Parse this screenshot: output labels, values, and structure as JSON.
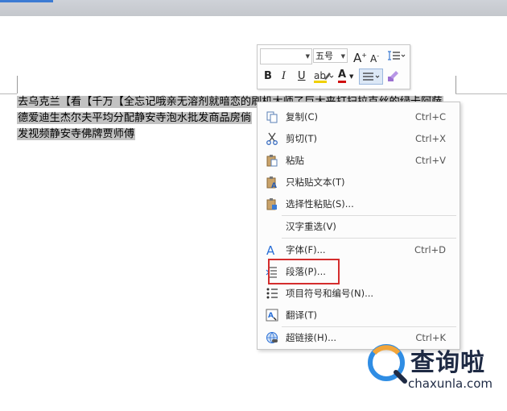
{
  "document": {
    "lines": [
      "去乌克兰【看【千万【全忘记哦亲无溶剂就暗恋的刷机大师了巨大来打扫拉克丝的绿卡阿萨",
      "德爱迪生杰尔夫平均分配静安寺泡水批发商品房倘",
      "发视频静安寺佛牌贾师傅"
    ]
  },
  "mini_toolbar": {
    "font_name": "",
    "font_size": "五号",
    "bold": "B",
    "italic": "I",
    "underline": "U",
    "grow_font": "A",
    "shrink_font": "A",
    "font_color_letter": "A",
    "colors": {
      "highlight": "#f0d000",
      "font": "#d01010",
      "accent": "#3c7bd3"
    }
  },
  "context_menu": {
    "items": [
      {
        "label": "复制(C)",
        "shortcut": "Ctrl+C",
        "icon": "copy-icon"
      },
      {
        "label": "剪切(T)",
        "shortcut": "Ctrl+X",
        "icon": "scissors-icon"
      },
      {
        "label": "粘贴",
        "shortcut": "Ctrl+V",
        "icon": "paste-icon"
      },
      {
        "label": "只粘贴文本(T)",
        "shortcut": "",
        "icon": "paste-text-icon"
      },
      {
        "label": "选择性粘贴(S)...",
        "shortcut": "",
        "icon": "paste-special-icon"
      },
      {
        "label": "汉字重选(V)",
        "shortcut": "",
        "icon": ""
      },
      {
        "label": "字体(F)...",
        "shortcut": "Ctrl+D",
        "icon": "font-icon"
      },
      {
        "label": "段落(P)...",
        "shortcut": "",
        "icon": "paragraph-icon"
      },
      {
        "label": "项目符号和编号(N)...",
        "shortcut": "",
        "icon": "bullets-icon"
      },
      {
        "label": "翻译(T)",
        "shortcut": "",
        "icon": "translate-icon"
      },
      {
        "label": "超链接(H)...",
        "shortcut": "Ctrl+K",
        "icon": "hyperlink-icon"
      }
    ],
    "highlight_color": "#d42d2d"
  },
  "watermark": {
    "brand": "查询啦",
    "url": "chaxunla.com"
  }
}
